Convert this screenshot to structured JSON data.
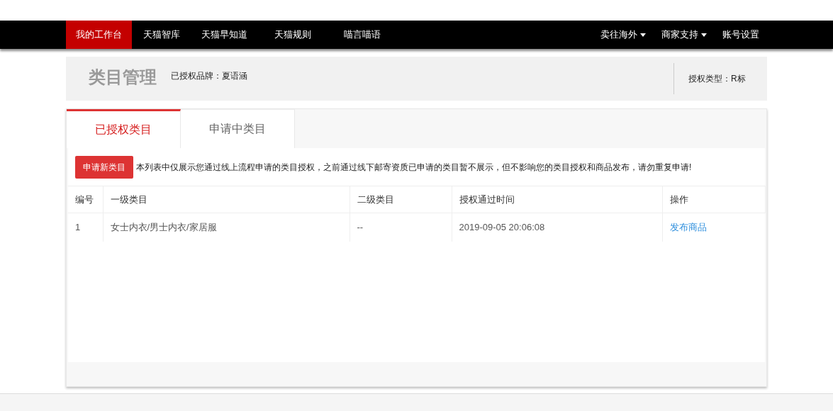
{
  "nav": {
    "left": [
      {
        "label": "我的工作台",
        "selected": true
      },
      {
        "label": "天猫智库",
        "selected": false
      },
      {
        "label": "天猫早知道",
        "selected": false
      },
      {
        "label": "天猫规则",
        "selected": false
      },
      {
        "label": "喵言喵语",
        "selected": false
      }
    ],
    "right": [
      {
        "label": "卖往海外",
        "dropdown": true
      },
      {
        "label": "商家支持",
        "dropdown": true
      },
      {
        "label": "账号设置",
        "dropdown": false
      }
    ]
  },
  "header": {
    "title": "类目管理",
    "brand": "已授权品牌：夏语涵",
    "auth_type": "授权类型：R标"
  },
  "tabs": [
    {
      "label": "已授权类目",
      "selected": true
    },
    {
      "label": "申请中类目",
      "selected": false
    }
  ],
  "apply_button": "申请新类目",
  "notice": "本列表中仅展示您通过线上流程申请的类目授权，之前通过线下邮寄资质已申请的类目暂不展示，但不影响您的类目授权和商品发布，请勿重复申请!",
  "table": {
    "columns": [
      "编号",
      "一级类目",
      "二级类目",
      "授权通过时间",
      "操作"
    ],
    "rows": [
      {
        "cells": [
          "1",
          "女士内衣/男士内衣/家居服",
          "--",
          "2019-09-05 20:06:08"
        ],
        "action": "发布商品"
      }
    ]
  }
}
